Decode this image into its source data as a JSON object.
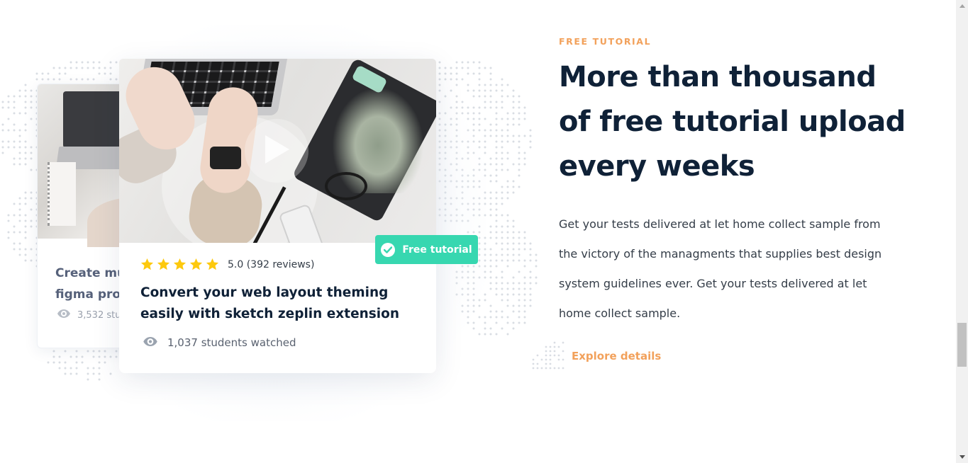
{
  "cards": {
    "back": {
      "title": "Create mu\nfigma prot",
      "views": "3,532 stu"
    },
    "front": {
      "badge": "Free tutorial",
      "rating": 5.0,
      "rating_text": "5.0 (392 reviews)",
      "title": "Convert your web layout theming easily with sketch zeplin extension",
      "views": "1,037 students watched"
    }
  },
  "section": {
    "eyebrow": "FREE TUTORIAL",
    "headline": "More than thousand of free tutorial upload every weeks",
    "body": "Get your tests delivered at let home collect sample from the victory of the managments that supplies best design system guidelines ever. Get your tests delivered at let home collect sample.",
    "cta": "Explore details"
  },
  "colors": {
    "accent": "#f2a15b",
    "badge": "#37d7b0",
    "star": "#fdc90e",
    "heading": "#0f2137",
    "text": "#343d48"
  },
  "icons": [
    "eye-icon",
    "play-icon",
    "check-circle-icon",
    "star-icon",
    "scroll-up-icon",
    "scroll-down-icon"
  ]
}
